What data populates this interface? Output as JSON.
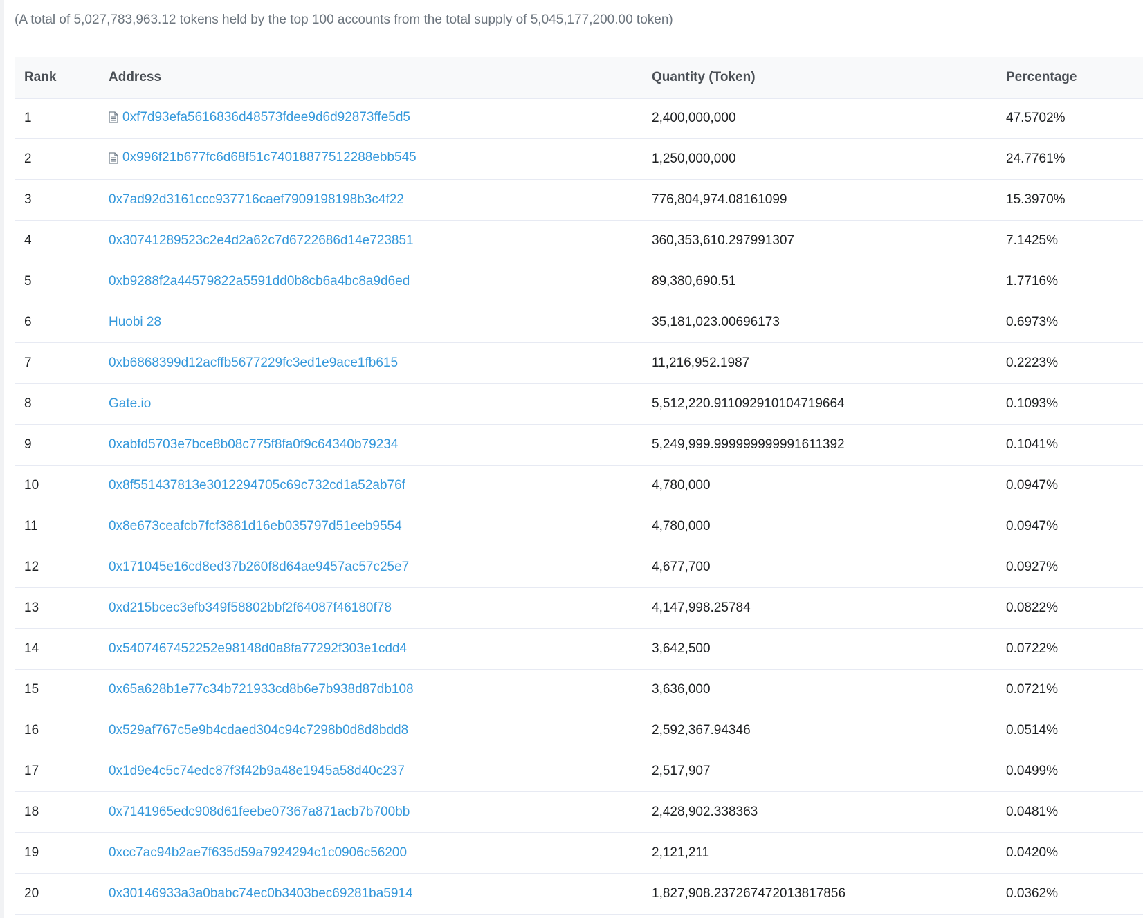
{
  "summary": "(A total of 5,027,783,963.12 tokens held by the top 100 accounts from the total supply of 5,045,177,200.00 token)",
  "table": {
    "headers": {
      "rank": "Rank",
      "address": "Address",
      "quantity": "Quantity (Token)",
      "percentage": "Percentage"
    },
    "rows": [
      {
        "rank": "1",
        "address": "0xf7d93efa5616836d48573fdee9d6d92873ffe5d5",
        "contract": true,
        "quantity": "2,400,000,000",
        "percentage": "47.5702%"
      },
      {
        "rank": "2",
        "address": "0x996f21b677fc6d68f51c74018877512288ebb545",
        "contract": true,
        "quantity": "1,250,000,000",
        "percentage": "24.7761%"
      },
      {
        "rank": "3",
        "address": "0x7ad92d3161ccc937716caef7909198198b3c4f22",
        "contract": false,
        "quantity": "776,804,974.08161099",
        "percentage": "15.3970%"
      },
      {
        "rank": "4",
        "address": "0x30741289523c2e4d2a62c7d6722686d14e723851",
        "contract": false,
        "quantity": "360,353,610.297991307",
        "percentage": "7.1425%"
      },
      {
        "rank": "5",
        "address": "0xb9288f2a44579822a5591dd0b8cb6a4bc8a9d6ed",
        "contract": false,
        "quantity": "89,380,690.51",
        "percentage": "1.7716%"
      },
      {
        "rank": "6",
        "address": "Huobi 28",
        "contract": false,
        "quantity": "35,181,023.00696173",
        "percentage": "0.6973%"
      },
      {
        "rank": "7",
        "address": "0xb6868399d12acffb5677229fc3ed1e9ace1fb615",
        "contract": false,
        "quantity": "11,216,952.1987",
        "percentage": "0.2223%"
      },
      {
        "rank": "8",
        "address": "Gate.io",
        "contract": false,
        "quantity": "5,512,220.911092910104719664",
        "percentage": "0.1093%"
      },
      {
        "rank": "9",
        "address": "0xabfd5703e7bce8b08c775f8fa0f9c64340b79234",
        "contract": false,
        "quantity": "5,249,999.999999999991611392",
        "percentage": "0.1041%"
      },
      {
        "rank": "10",
        "address": "0x8f551437813e3012294705c69c732cd1a52ab76f",
        "contract": false,
        "quantity": "4,780,000",
        "percentage": "0.0947%"
      },
      {
        "rank": "11",
        "address": "0x8e673ceafcb7fcf3881d16eb035797d51eeb9554",
        "contract": false,
        "quantity": "4,780,000",
        "percentage": "0.0947%"
      },
      {
        "rank": "12",
        "address": "0x171045e16cd8ed37b260f8d64ae9457ac57c25e7",
        "contract": false,
        "quantity": "4,677,700",
        "percentage": "0.0927%"
      },
      {
        "rank": "13",
        "address": "0xd215bcec3efb349f58802bbf2f64087f46180f78",
        "contract": false,
        "quantity": "4,147,998.25784",
        "percentage": "0.0822%"
      },
      {
        "rank": "14",
        "address": "0x5407467452252e98148d0a8fa77292f303e1cdd4",
        "contract": false,
        "quantity": "3,642,500",
        "percentage": "0.0722%"
      },
      {
        "rank": "15",
        "address": "0x65a628b1e77c34b721933cd8b6e7b938d87db108",
        "contract": false,
        "quantity": "3,636,000",
        "percentage": "0.0721%"
      },
      {
        "rank": "16",
        "address": "0x529af767c5e9b4cdaed304c94c7298b0d8d8bdd8",
        "contract": false,
        "quantity": "2,592,367.94346",
        "percentage": "0.0514%"
      },
      {
        "rank": "17",
        "address": "0x1d9e4c5c74edc87f3f42b9a48e1945a58d40c237",
        "contract": false,
        "quantity": "2,517,907",
        "percentage": "0.0499%"
      },
      {
        "rank": "18",
        "address": "0x7141965edc908d61feebe07367a871acb7b700bb",
        "contract": false,
        "quantity": "2,428,902.338363",
        "percentage": "0.0481%"
      },
      {
        "rank": "19",
        "address": "0xcc7ac94b2ae7f635d59a7924294c1c0906c56200",
        "contract": false,
        "quantity": "2,121,211",
        "percentage": "0.0420%"
      },
      {
        "rank": "20",
        "address": "0x30146933a3a0babc74ec0b3403bec69281ba5914",
        "contract": false,
        "quantity": "1,827,908.237267472013817856",
        "percentage": "0.0362%"
      }
    ]
  },
  "colors": {
    "link": "#3498db",
    "text": "#1e2022",
    "muted": "#6c757e",
    "header_bg": "#f8f9fa",
    "border": "#e7eaf3"
  },
  "icons": {
    "contract": "contract-file-icon"
  }
}
